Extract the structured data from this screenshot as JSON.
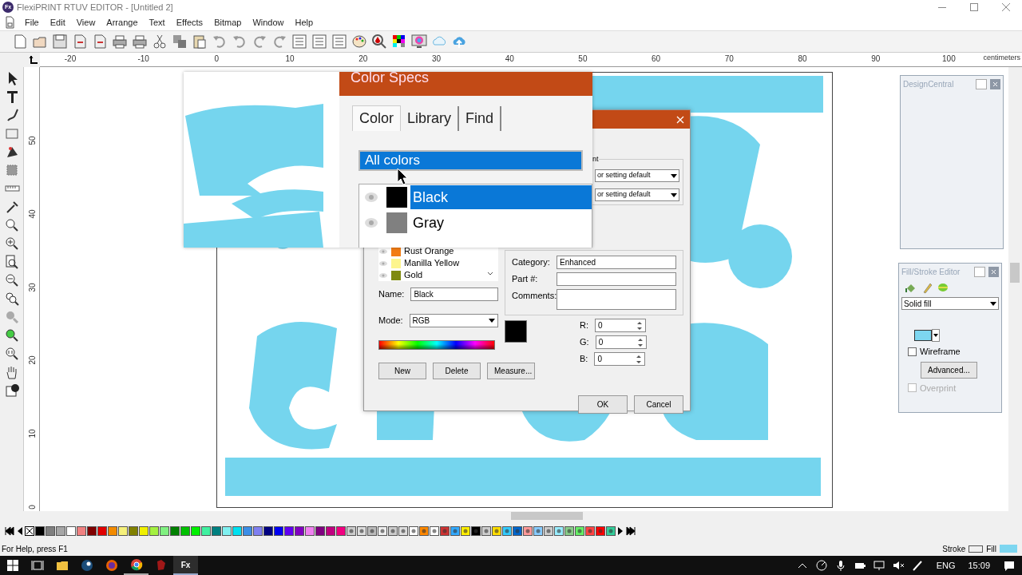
{
  "window": {
    "app_icon": "Fx",
    "title": "FlexiPRINT RTUV EDITOR - [Untitled 2]"
  },
  "menu": [
    "File",
    "Edit",
    "View",
    "Arrange",
    "Text",
    "Effects",
    "Bitmap",
    "Window",
    "Help"
  ],
  "ruler": {
    "h_labels": [
      "-20",
      "-10",
      "0",
      "10",
      "20",
      "30",
      "40",
      "50",
      "60",
      "70",
      "80",
      "90",
      "100"
    ],
    "unit": "centimeters",
    "v_labels": [
      "50",
      "40",
      "30",
      "20",
      "10",
      "0"
    ]
  },
  "design_central": {
    "title": "DesignCentral"
  },
  "fill_stroke": {
    "title": "Fill/Stroke Editor",
    "fill_type": "Solid fill",
    "wireframe": {
      "label": "Wireframe",
      "checked": false
    },
    "advanced": "Advanced...",
    "overprint": {
      "label": "Overprint",
      "checked": false,
      "disabled": true
    }
  },
  "color_specs": {
    "title": "Color Specs",
    "tabs": [
      {
        "label": "Color",
        "selected": true
      },
      {
        "label": "Library",
        "selected": false
      },
      {
        "label": "Find",
        "selected": false
      }
    ],
    "filter": "All colors",
    "zoom_list": [
      {
        "name": "Black",
        "color": "#000000",
        "selected": true
      },
      {
        "name": "Gray",
        "color": "#808080",
        "selected": false
      }
    ],
    "group_label": "nt",
    "dropdowns": [
      "or setting default",
      "or setting default"
    ],
    "category_label": "Category:",
    "category": "Enhanced",
    "part_label": "Part #:",
    "comments_label": "Comments:",
    "list": [
      {
        "name": "Rust Orange",
        "color": "#f27c14"
      },
      {
        "name": "Manilla Yellow",
        "color": "#fdf58e"
      },
      {
        "name": "Gold",
        "color": "#7f8a10"
      }
    ],
    "name_label": "Name:",
    "name": "Black",
    "mode_label": "Mode:",
    "mode": "RGB",
    "channels": [
      {
        "label": "R:",
        "value": "0"
      },
      {
        "label": "G:",
        "value": "0"
      },
      {
        "label": "B:",
        "value": "0"
      }
    ],
    "buttons": [
      "New",
      "Delete",
      "Measure..."
    ],
    "ok": "OK",
    "cancel": "Cancel"
  },
  "palette": [
    {
      "color": "#000000"
    },
    {
      "color": "#7f7f7f"
    },
    {
      "color": "#a6a6a6"
    },
    {
      "color": "#ffffff"
    },
    {
      "color": "#f08080"
    },
    {
      "color": "#800000"
    },
    {
      "color": "#e00000"
    },
    {
      "color": "#f28a00"
    },
    {
      "color": "#f5f07a"
    },
    {
      "color": "#808000"
    },
    {
      "color": "#f0f000"
    },
    {
      "color": "#a4f040"
    },
    {
      "color": "#80f080"
    },
    {
      "color": "#008000"
    },
    {
      "color": "#00c000"
    },
    {
      "color": "#00f000"
    },
    {
      "color": "#40f0a0"
    },
    {
      "color": "#008080"
    },
    {
      "color": "#80f0f0"
    },
    {
      "color": "#00e0f0"
    },
    {
      "color": "#3c8ee6"
    },
    {
      "color": "#8080f0"
    },
    {
      "color": "#000080"
    },
    {
      "color": "#0000f0"
    },
    {
      "color": "#6000f0"
    },
    {
      "color": "#8000c0"
    },
    {
      "color": "#f080f0"
    },
    {
      "color": "#800080"
    },
    {
      "color": "#c00080"
    },
    {
      "color": "#f00080"
    }
  ],
  "status_bar": {
    "help": "For Help, press F1",
    "stroke_label": "Stroke",
    "fill_label": "Fill"
  },
  "taskbar": {
    "app_icon": "Fx",
    "language": "ENG",
    "time": "15:09"
  }
}
